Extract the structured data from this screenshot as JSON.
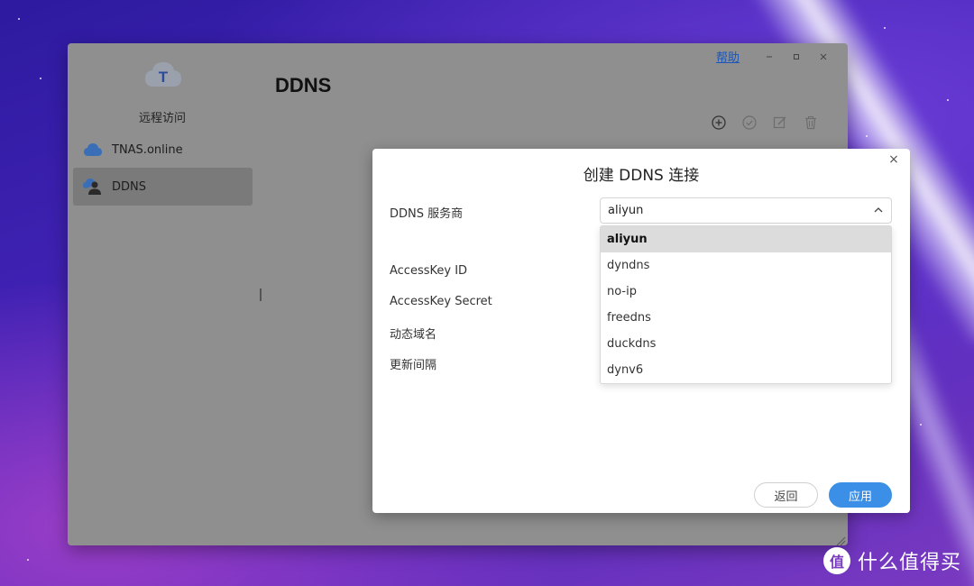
{
  "window": {
    "help_label": "帮助",
    "app_title": "远程访问",
    "app_icon_letter": "T",
    "page_title": "DDNS"
  },
  "sidebar": {
    "items": [
      {
        "label": "TNAS.online",
        "icon": "cloud-icon",
        "active": false
      },
      {
        "label": "DDNS",
        "icon": "ddns-user-icon",
        "active": true
      }
    ]
  },
  "toolbar": {
    "icons": [
      "add-circle-icon",
      "check-circle-icon",
      "edit-icon",
      "trash-icon"
    ]
  },
  "dialog": {
    "title": "创建 DDNS 连接",
    "close_glyph": "×",
    "labels": {
      "provider": "DDNS 服务商",
      "access_key_id": "AccessKey ID",
      "access_key_secret": "AccessKey Secret",
      "domain": "动态域名",
      "interval": "更新间隔"
    },
    "provider_select": {
      "value": "aliyun",
      "options": [
        "aliyun",
        "dyndns",
        "no-ip",
        "freedns",
        "duckdns",
        "dynv6"
      ]
    },
    "back_label": "返回",
    "apply_label": "应用"
  },
  "watermark": {
    "logo": "值",
    "text": "什么值得买"
  },
  "colors": {
    "accent": "#3b8fe6",
    "link": "#1a56b8",
    "window_dim": "#8f8f8f"
  }
}
